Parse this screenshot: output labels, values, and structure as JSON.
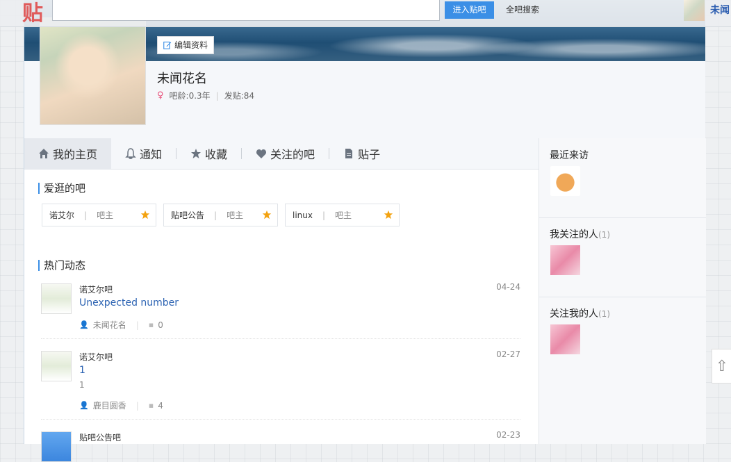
{
  "topbar": {
    "logo": "贴",
    "search_placeholder": "",
    "enter_button": "进入贴吧",
    "search_all": "全吧搜索",
    "username": "未闻"
  },
  "profile": {
    "edit_button": "编辑资料",
    "name": "未闻花名",
    "age": "吧龄:0.3年",
    "posts": "发贴:84"
  },
  "tabs": [
    {
      "label": "我的主页",
      "icon": "home-icon",
      "active": true
    },
    {
      "label": "通知",
      "icon": "bell-icon",
      "active": false
    },
    {
      "label": "收藏",
      "icon": "star-icon",
      "active": false
    },
    {
      "label": "关注的吧",
      "icon": "heart-icon",
      "active": false
    },
    {
      "label": "贴子",
      "icon": "document-icon",
      "active": false
    }
  ],
  "favorites": {
    "title": "爱逛的吧",
    "items": [
      {
        "name": "诺艾尔",
        "role": "吧主"
      },
      {
        "name": "贴吧公告",
        "role": "吧主"
      },
      {
        "name": "linux",
        "role": "吧主"
      }
    ]
  },
  "feed": {
    "title": "热门动态",
    "items": [
      {
        "forum": "诺艾尔吧",
        "date": "04-24",
        "title": "Unexpected number",
        "summary": "",
        "author": "未闻花名",
        "replies": "0"
      },
      {
        "forum": "诺艾尔吧",
        "date": "02-27",
        "title": "1",
        "summary": "1",
        "author": "鹿目圆香",
        "replies": "4"
      },
      {
        "forum": "贴吧公告吧",
        "date": "02-23",
        "title": "",
        "summary": "",
        "author": "",
        "replies": ""
      }
    ]
  },
  "sidebar": {
    "recent_visitors": "最近来访",
    "following": "我关注的人",
    "following_count": "(1)",
    "followers": "关注我的人",
    "followers_count": "(1)"
  }
}
